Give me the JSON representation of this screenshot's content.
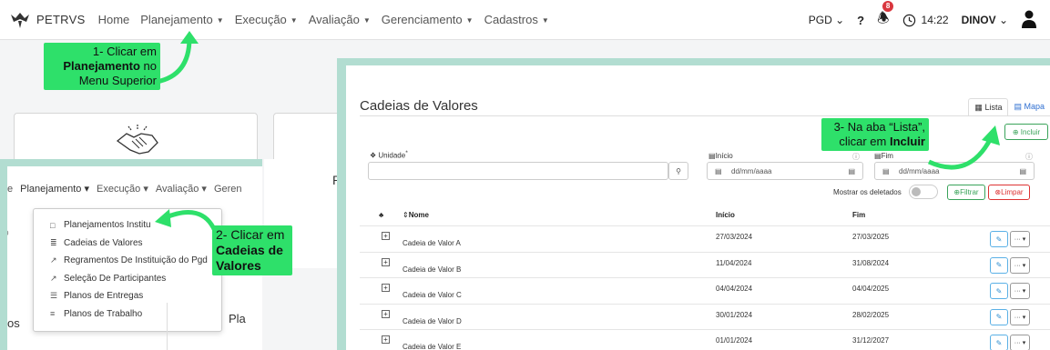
{
  "navbar": {
    "brand": "PETRVS",
    "menu": [
      {
        "label": "Home",
        "caret": false
      },
      {
        "label": "Planejamento",
        "caret": true
      },
      {
        "label": "Execução",
        "caret": true
      },
      {
        "label": "Avaliação",
        "caret": true
      },
      {
        "label": "Gerenciamento",
        "caret": true
      },
      {
        "label": "Cadastros",
        "caret": true
      }
    ],
    "pgd": "PGD",
    "help": "?",
    "notifications": "8",
    "time": "14:22",
    "user": "DINOV"
  },
  "callouts": {
    "step1_a": "1- Clicar em",
    "step1_b": "Planejamento",
    "step1_c": " no",
    "step1_d": "Menu Superior",
    "step2_a": "2- Clicar em",
    "step2_b": "Cadeias de Valores",
    "step3_a": "3- Na aba “Lista”,",
    "step3_b": "clicar em ",
    "step3_c": "Incluir"
  },
  "zoom_menu": {
    "nav": [
      "e",
      "Planejamento ▾",
      "Execução ▾",
      "Avaliação ▾",
      "Geren"
    ],
    "items": [
      {
        "icon": "□",
        "label": "Planejamentos Institu"
      },
      {
        "icon": "≣",
        "label": "Cadeias de Valores"
      },
      {
        "icon": "↗",
        "label": "Regramentos De Instituição do Pgd"
      },
      {
        "icon": "↗",
        "label": "Seleção De Participantes"
      },
      {
        "icon": "☰",
        "label": "Planos de Entregas"
      },
      {
        "icon": "≡",
        "label": "Planos de Trabalho"
      }
    ],
    "bottom_left": "os",
    "bottom_right": "Pla",
    "side_o": "o"
  },
  "background": {
    "partial_p": "P"
  },
  "cadeias": {
    "title": "Cadeias de Valores",
    "tab_lista": "Lista",
    "tab_mapa": "Mapa",
    "btn_incluir": "Incluir",
    "label_unidade": "Unidade",
    "label_inicio": "Início",
    "label_fim": "Fim",
    "date_placeholder": "dd/mm/aaaa",
    "show_deleted": "Mostrar os deletados",
    "btn_filtrar": "Filtrar",
    "btn_limpar": "Limpar",
    "columns": {
      "nome": "Nome",
      "inicio": "Início",
      "fim": "Fim"
    },
    "rows": [
      {
        "nome": "Cadeia de Valor A",
        "inicio": "27/03/2024",
        "fim": "27/03/2025"
      },
      {
        "nome": "Cadeia de Valor B",
        "inicio": "11/04/2024",
        "fim": "31/08/2024"
      },
      {
        "nome": "Cadeia de Valor C",
        "inicio": "04/04/2024",
        "fim": "04/04/2025"
      },
      {
        "nome": "Cadeia de Valor D",
        "inicio": "30/01/2024",
        "fim": "28/02/2025"
      },
      {
        "nome": "Cadeia de Valor E",
        "inicio": "01/01/2024",
        "fim": "31/12/2027"
      }
    ]
  },
  "colors": {
    "callout": "#2ee06a",
    "inset_bg": "#b2ddd1",
    "success": "#3aa35a",
    "danger": "#dd3333",
    "link": "#2f6fd1"
  }
}
